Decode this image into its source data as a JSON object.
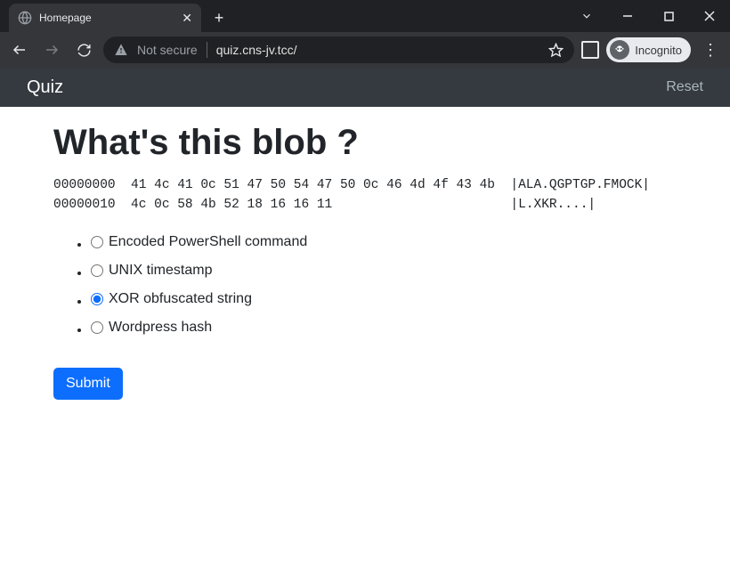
{
  "browser": {
    "tab_title": "Homepage",
    "not_secure_label": "Not secure",
    "url": "quiz.cns-jv.tcc/",
    "incognito_label": "Incognito"
  },
  "appnav": {
    "brand": "Quiz",
    "reset": "Reset"
  },
  "quiz": {
    "heading": "What's this blob ?",
    "hex_line1": "00000000  41 4c 41 0c 51 47 50 54 47 50 0c 46 4d 4f 43 4b  |ALA.QGPTGP.FMOCK|",
    "hex_line2": "00000010  4c 0c 58 4b 52 18 16 16 11                       |L.XKR....|",
    "options": [
      {
        "label": "Encoded PowerShell command",
        "checked": false
      },
      {
        "label": "UNIX timestamp",
        "checked": false
      },
      {
        "label": "XOR obfuscated string",
        "checked": true
      },
      {
        "label": "Wordpress hash",
        "checked": false
      }
    ],
    "submit_label": "Submit"
  }
}
